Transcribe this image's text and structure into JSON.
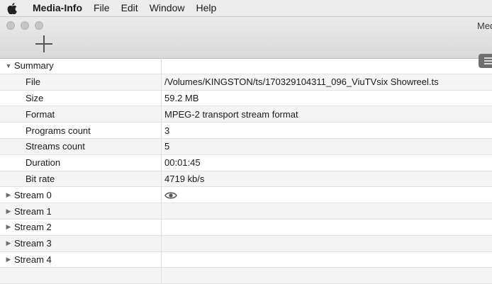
{
  "menubar": {
    "app_name": "Media-Info",
    "items": [
      "File",
      "Edit",
      "Window",
      "Help"
    ]
  },
  "window": {
    "title": "Med"
  },
  "icons": {
    "apple": "apple-icon",
    "add": "plus-icon",
    "view": "list-view-icon",
    "eye": "eye-icon"
  },
  "colors": {
    "menubar_bg": "#ececec",
    "toolbar_bg": "#dddddd",
    "row_alt": "#f4f4f4"
  },
  "summary": {
    "label": "Summary",
    "rows": [
      {
        "key": "File",
        "value": "/Volumes/KINGSTON/ts/170329104311_096_ViuTVsix Showreel.ts"
      },
      {
        "key": "Size",
        "value": "59.2 MB"
      },
      {
        "key": "Format",
        "value": "MPEG-2 transport stream format"
      },
      {
        "key": "Programs count",
        "value": "3"
      },
      {
        "key": "Streams count",
        "value": "5"
      },
      {
        "key": "Duration",
        "value": "00:01:45"
      },
      {
        "key": "Bit rate",
        "value": "4719 kb/s"
      }
    ]
  },
  "streams": [
    "Stream 0",
    "Stream 1",
    "Stream 2",
    "Stream 3",
    "Stream 4"
  ]
}
